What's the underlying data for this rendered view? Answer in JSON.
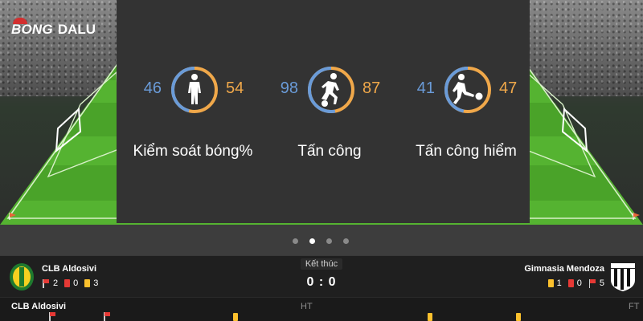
{
  "brand": {
    "part1": "BONG",
    "part2": "DALU"
  },
  "stats": [
    {
      "left": "46",
      "right": "54",
      "left_pct": 46,
      "label": "Kiểm soát bóng%",
      "icon": "standing-player-icon"
    },
    {
      "left": "98",
      "right": "87",
      "left_pct": 53,
      "label": "Tấn công",
      "icon": "running-player-icon"
    },
    {
      "left": "41",
      "right": "47",
      "left_pct": 47,
      "label": "Tấn công hiểm",
      "icon": "kicking-player-icon"
    }
  ],
  "carousel": {
    "count": 4,
    "active_index": 1
  },
  "match": {
    "status": "Kết thúc",
    "score": "0 : 0",
    "home": {
      "name": "CLB Aldosivi",
      "corners": "2",
      "red": "0",
      "yellow": "3"
    },
    "away": {
      "name": "Gimnasia Mendoza",
      "yellow": "1",
      "red": "0",
      "corners": "5"
    }
  },
  "timeline": {
    "team": "CLB Aldosivi",
    "ht": "HT",
    "ft": "FT"
  },
  "colors": {
    "home": "#6a9bd8",
    "away": "#f0a84a",
    "panel": "#333333",
    "pitch": "#4caf2e"
  }
}
